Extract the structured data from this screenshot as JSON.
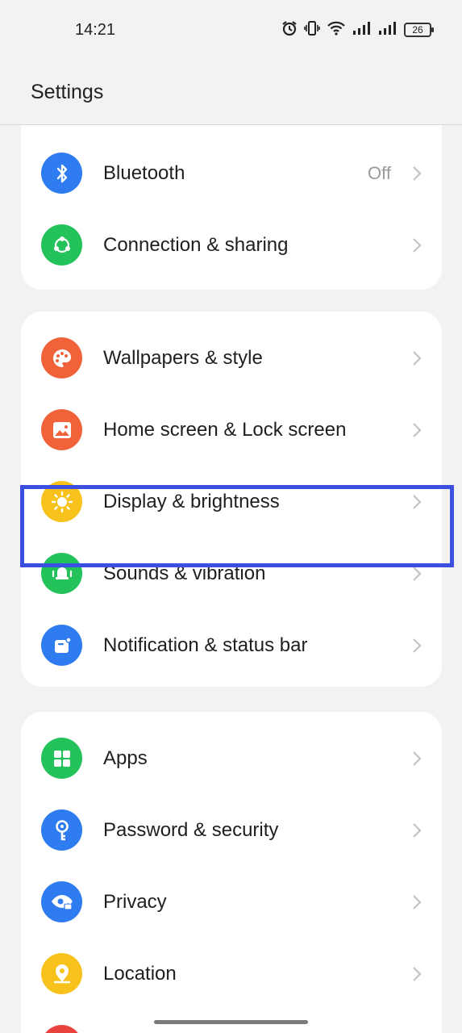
{
  "status_bar": {
    "time": "14:21",
    "battery": "26"
  },
  "header": {
    "title": "Settings"
  },
  "groups": [
    {
      "items": [
        {
          "label": "Bluetooth",
          "value": "Off",
          "icon": "bluetooth-icon",
          "color": "#2f7bf0"
        },
        {
          "label": "Connection & sharing",
          "icon": "share-icon",
          "color": "#23c25a"
        }
      ]
    },
    {
      "items": [
        {
          "label": "Wallpapers & style",
          "icon": "palette-icon",
          "color": "#f2623a"
        },
        {
          "label": "Home screen & Lock screen",
          "icon": "picture-icon",
          "color": "#f2623a"
        },
        {
          "label": "Display & brightness",
          "icon": "sun-icon",
          "color": "#f7c21b"
        },
        {
          "label": "Sounds & vibration",
          "icon": "bell-icon",
          "color": "#23c25a"
        },
        {
          "label": "Notification & status bar",
          "icon": "notification-icon",
          "color": "#2f7bf0"
        }
      ]
    },
    {
      "items": [
        {
          "label": "Apps",
          "icon": "apps-grid-icon",
          "color": "#23c25a"
        },
        {
          "label": "Password & security",
          "icon": "key-icon",
          "color": "#2f7bf0"
        },
        {
          "label": "Privacy",
          "icon": "eye-lock-icon",
          "color": "#2f7bf0"
        },
        {
          "label": "Location",
          "icon": "location-pin-icon",
          "color": "#f7c21b"
        }
      ]
    }
  ]
}
